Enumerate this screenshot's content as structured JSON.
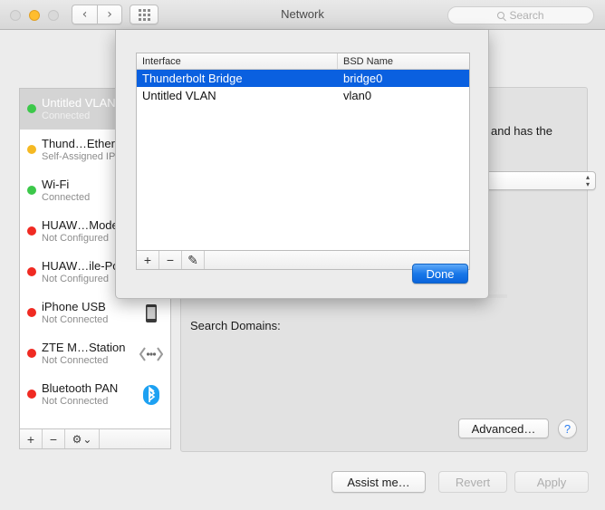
{
  "window": {
    "title": "Network",
    "traffic_lights": [
      {
        "name": "close",
        "color": "#d9d9d9",
        "enabled": false
      },
      {
        "name": "minimize",
        "color": "#ffbd2e",
        "enabled": true
      },
      {
        "name": "zoom",
        "color": "#d9d9d9",
        "enabled": false
      }
    ],
    "toolbar": {
      "back_icon": "chevron-left-icon",
      "forward_icon": "chevron-right-icon",
      "show_all_icon": "grid-dots-icon",
      "back_label": "‹",
      "forward_label": "›"
    },
    "search": {
      "placeholder": "Search",
      "icon": "search-icon",
      "value": ""
    }
  },
  "sidebar": {
    "items": [
      {
        "name": "Untitled VLAN",
        "status": "Connected",
        "dot": "#3cc84a",
        "selected": true,
        "icon": ""
      },
      {
        "name": "Thund…Ether",
        "status": "Self-Assigned IP",
        "dot": "#f5b923",
        "selected": false,
        "icon": ""
      },
      {
        "name": "Wi-Fi",
        "status": "Connected",
        "dot": "#3cc84a",
        "selected": false,
        "icon": ""
      },
      {
        "name": "HUAW…Mode",
        "status": "Not Configured",
        "dot": "#f02a22",
        "selected": false,
        "icon": ""
      },
      {
        "name": "HUAW…ile-Po",
        "status": "Not Configured",
        "dot": "#f02a22",
        "selected": false,
        "icon": ""
      },
      {
        "name": "iPhone USB",
        "status": "Not Connected",
        "dot": "#f02a22",
        "selected": false,
        "icon": "iphone-icon"
      },
      {
        "name": "ZTE M…Station",
        "status": "Not Connected",
        "dot": "#f02a22",
        "selected": false,
        "icon": "modem-icon"
      },
      {
        "name": "Bluetooth PAN",
        "status": "Not Connected",
        "dot": "#f02a22",
        "selected": false,
        "icon": "bluetooth-icon"
      }
    ],
    "toolbar": {
      "add_label": "+",
      "remove_label": "−",
      "gear_label": "⚙",
      "gear_chevron": "⌄",
      "add_icon": "plus-icon",
      "remove_icon": "minus-icon",
      "action_icon": "gear-icon"
    }
  },
  "main": {
    "headline_fragment": "and has the",
    "search_domains_label": "Search Domains:",
    "configure_popup_value": "",
    "advanced_button": "Advanced…",
    "help_button": "?",
    "popup_stepper_up": "▴",
    "popup_stepper_down": "▾"
  },
  "bottom_bar": {
    "assist": {
      "label": "Assist me…",
      "enabled": true
    },
    "revert": {
      "label": "Revert",
      "enabled": false
    },
    "apply": {
      "label": "Apply",
      "enabled": false
    }
  },
  "sheet": {
    "table": {
      "columns": [
        "Interface",
        "BSD Name"
      ],
      "rows": [
        {
          "interface": "Thunderbolt Bridge",
          "bsd_name": "bridge0",
          "selected": true
        },
        {
          "interface": "Untitled VLAN",
          "bsd_name": "vlan0",
          "selected": false
        }
      ]
    },
    "toolbar": {
      "add_label": "+",
      "remove_label": "−",
      "edit_label": "✎",
      "add_icon": "plus-icon",
      "remove_icon": "minus-icon",
      "edit_icon": "pencil-icon"
    },
    "done_button": "Done"
  },
  "colors": {
    "accent_blue": "#0a60e0",
    "selection_gray": "#d4d4d4",
    "status_connected": "#3cc84a",
    "status_warning": "#f5b923",
    "status_error": "#f02a22"
  }
}
